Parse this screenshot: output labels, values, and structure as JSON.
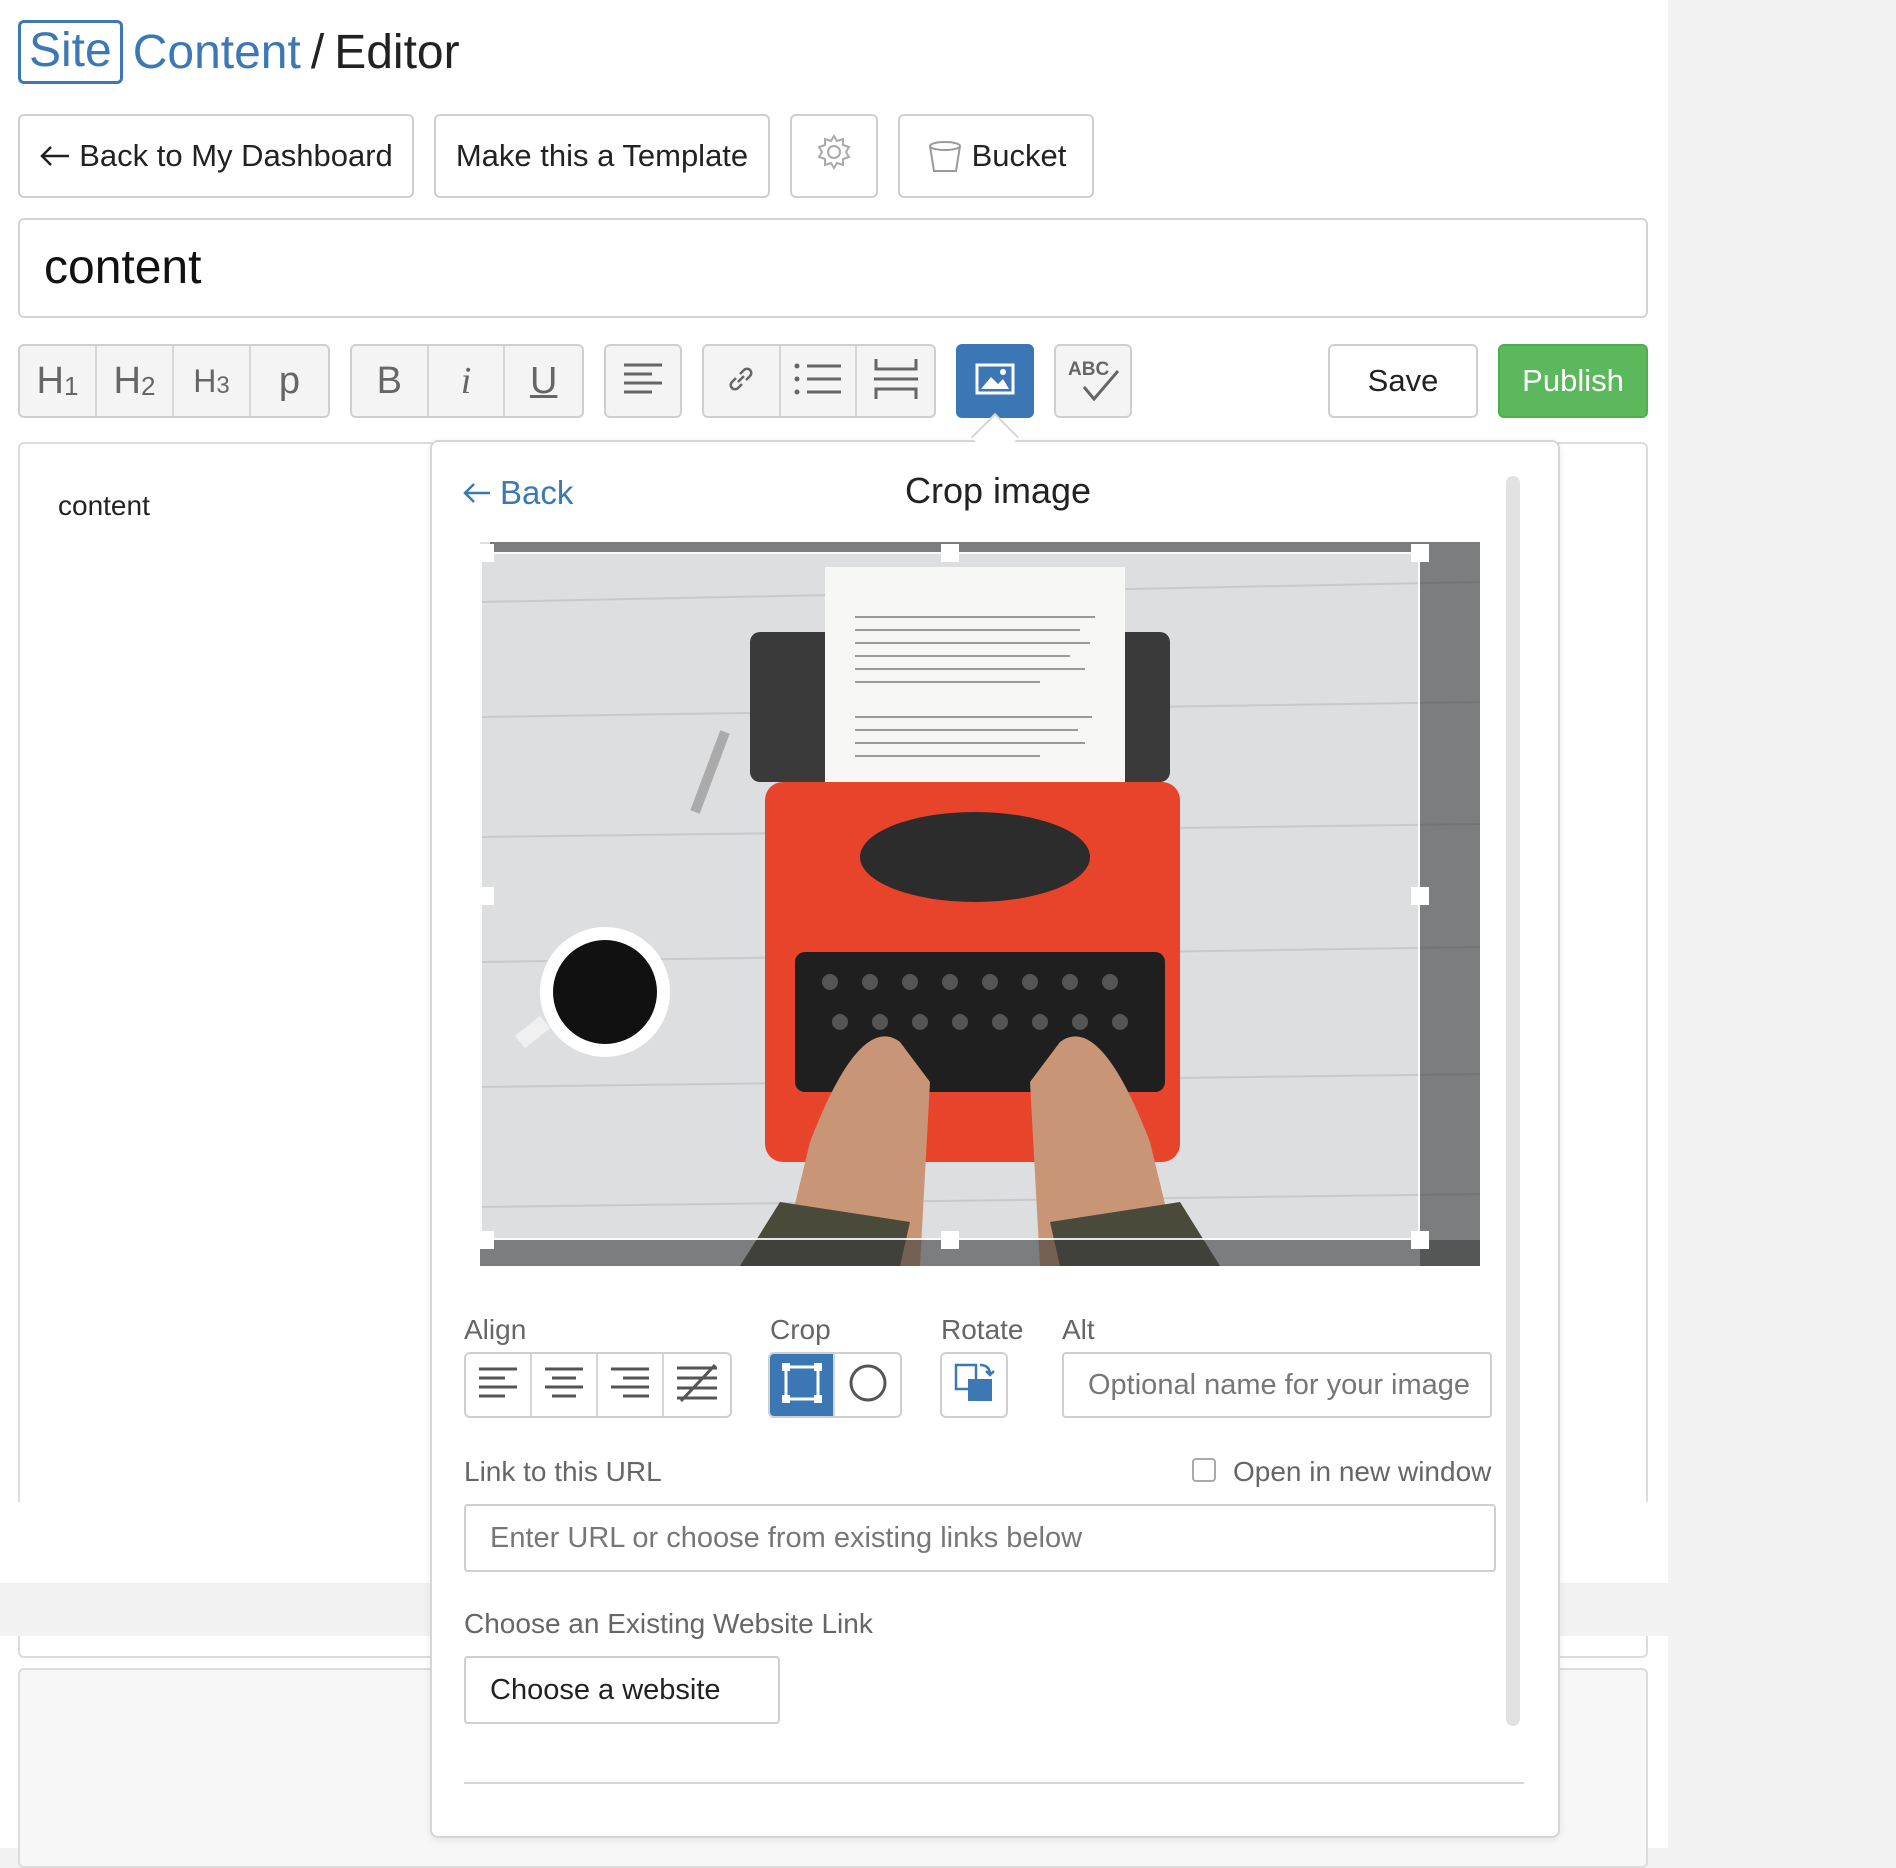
{
  "breadcrumb": {
    "site": "Site",
    "content": "Content",
    "separator": "/",
    "editor": "Editor"
  },
  "top_buttons": {
    "back": "Back to My Dashboard",
    "template": "Make this a Template",
    "bucket": "Bucket"
  },
  "title_input": {
    "value": "content"
  },
  "toolbar": {
    "h1": "H",
    "h1_sub": "1",
    "h2": "H",
    "h2_sub": "2",
    "h3": "H",
    "h3_sub": "3",
    "p": "p",
    "bold": "B",
    "italic": "i",
    "underline": "U",
    "spell": "ABC",
    "save": "Save",
    "publish": "Publish"
  },
  "editor": {
    "body_text": "content"
  },
  "popup": {
    "back": "Back",
    "title": "Crop image",
    "align_label": "Align",
    "crop_label": "Crop",
    "rotate_label": "Rotate",
    "alt_label": "Alt",
    "alt_placeholder": "Optional name for your image",
    "link_label": "Link to this URL",
    "new_window_label": "Open in new window",
    "url_placeholder": "Enter URL or choose from existing links below",
    "existing_label": "Choose an Existing Website Link",
    "choose_button": "Choose a website"
  },
  "colors": {
    "accent": "#3b78b4",
    "publish": "#5cb85c",
    "active_tool": "#3b76b5"
  }
}
